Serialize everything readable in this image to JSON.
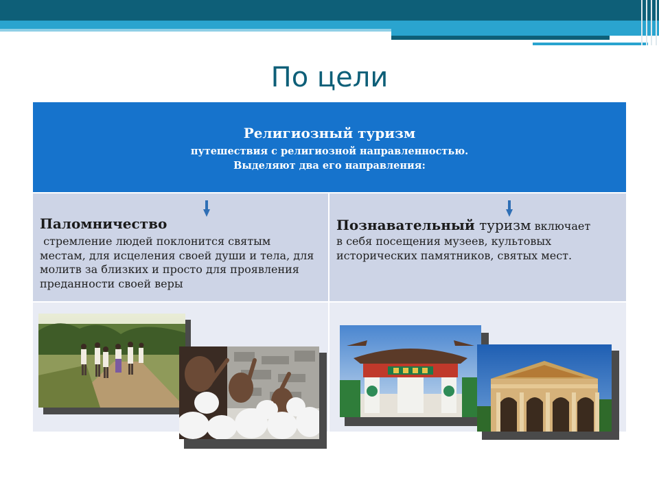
{
  "slide": {
    "title": "По цели"
  },
  "header": {
    "title": "Религиозный туризм",
    "subtitle_line1": "путешествия с религиозной направленностью.",
    "subtitle_line2": "Выделяют два его направления:"
  },
  "left": {
    "heading": "Паломничество",
    "body_line1": " стремление людей поклонится святым",
    "body_line2": "местам, для исцеления своей души и тела, для",
    "body_line3": "молитв за близких и просто для проявления",
    "body_line4": "преданности своей веры"
  },
  "right": {
    "heading_bold": "Познавательный",
    "heading_normal": " туризм",
    "heading_small": " включает",
    "body_line1": "в себя посещения музеев, культовых",
    "body_line2": "исторических памятников, святых мест."
  },
  "icons": {
    "left_arrow": "down-arrow-icon",
    "right_arrow": "down-arrow-icon"
  },
  "colors": {
    "header_blue": "#1673cc",
    "title_teal": "#0e5f78",
    "arrow_blue": "#2f6fb5"
  }
}
